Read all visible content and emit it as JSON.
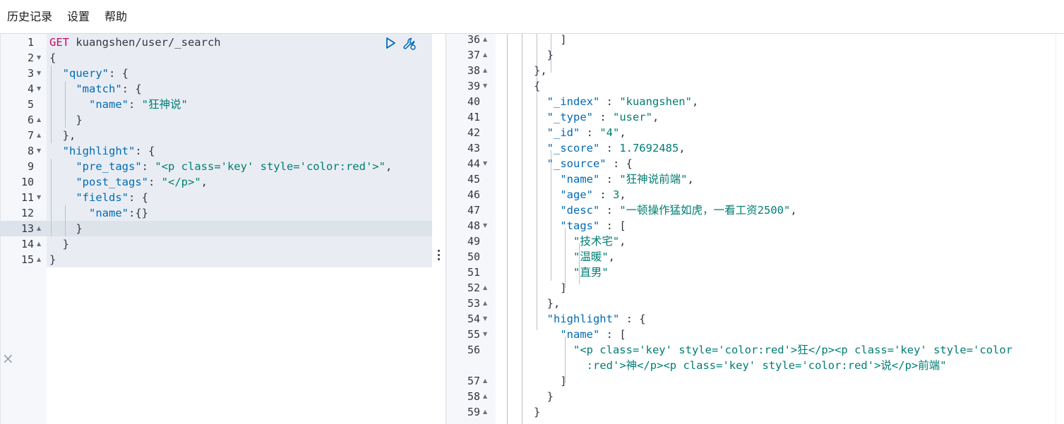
{
  "menu": {
    "history": "历史记录",
    "settings": "设置",
    "help": "帮助"
  },
  "request": {
    "lines": [
      {
        "n": "1",
        "fold": "",
        "t": [
          [
            "k-method",
            "GET"
          ],
          [
            "k-url",
            " kuangshen/user/_search"
          ]
        ]
      },
      {
        "n": "2",
        "fold": "▼",
        "t": [
          [
            "k-punc",
            "{"
          ]
        ]
      },
      {
        "n": "3",
        "fold": "▼",
        "t": [
          [
            "k-punc",
            "  "
          ],
          [
            "k-key",
            "\"query\""
          ],
          [
            "k-punc",
            ": {"
          ]
        ]
      },
      {
        "n": "4",
        "fold": "▼",
        "t": [
          [
            "k-punc",
            "    "
          ],
          [
            "k-key",
            "\"match\""
          ],
          [
            "k-punc",
            ": {"
          ]
        ]
      },
      {
        "n": "5",
        "fold": "",
        "t": [
          [
            "k-punc",
            "      "
          ],
          [
            "k-key",
            "\"name\""
          ],
          [
            "k-punc",
            ": "
          ],
          [
            "k-str",
            "\"狂神说\""
          ]
        ]
      },
      {
        "n": "6",
        "fold": "▲",
        "t": [
          [
            "k-punc",
            "    }"
          ]
        ]
      },
      {
        "n": "7",
        "fold": "▲",
        "t": [
          [
            "k-punc",
            "  },"
          ]
        ]
      },
      {
        "n": "8",
        "fold": "▼",
        "t": [
          [
            "k-punc",
            "  "
          ],
          [
            "k-key",
            "\"highlight\""
          ],
          [
            "k-punc",
            ": {"
          ]
        ]
      },
      {
        "n": "9",
        "fold": "",
        "t": [
          [
            "k-punc",
            "    "
          ],
          [
            "k-key",
            "\"pre_tags\""
          ],
          [
            "k-punc",
            ": "
          ],
          [
            "k-str",
            "\"<p class='key' style='color:red'>\""
          ],
          [
            "k-punc",
            ","
          ]
        ]
      },
      {
        "n": "10",
        "fold": "",
        "t": [
          [
            "k-punc",
            "    "
          ],
          [
            "k-key",
            "\"post_tags\""
          ],
          [
            "k-punc",
            ": "
          ],
          [
            "k-str",
            "\"</p>\""
          ],
          [
            "k-punc",
            ","
          ]
        ]
      },
      {
        "n": "11",
        "fold": "▼",
        "t": [
          [
            "k-punc",
            "    "
          ],
          [
            "k-key",
            "\"fields\""
          ],
          [
            "k-punc",
            ": {"
          ]
        ]
      },
      {
        "n": "12",
        "fold": "",
        "t": [
          [
            "k-punc",
            "      "
          ],
          [
            "k-key",
            "\"name\""
          ],
          [
            "k-punc",
            ":{}"
          ]
        ]
      },
      {
        "n": "13",
        "fold": "▲",
        "t": [
          [
            "k-punc",
            "    }"
          ]
        ]
      },
      {
        "n": "14",
        "fold": "▲",
        "t": [
          [
            "k-punc",
            "  }"
          ]
        ]
      },
      {
        "n": "15",
        "fold": "▲",
        "t": [
          [
            "k-punc",
            "}"
          ]
        ]
      }
    ]
  },
  "response": {
    "lines": [
      {
        "n": "36",
        "fold": "▲",
        "t": [
          [
            "k-punc",
            "          ]"
          ]
        ]
      },
      {
        "n": "37",
        "fold": "▲",
        "t": [
          [
            "k-punc",
            "        }"
          ]
        ]
      },
      {
        "n": "38",
        "fold": "▲",
        "t": [
          [
            "k-punc",
            "      },"
          ]
        ]
      },
      {
        "n": "39",
        "fold": "▼",
        "t": [
          [
            "k-punc",
            "      {"
          ]
        ]
      },
      {
        "n": "40",
        "fold": "",
        "t": [
          [
            "k-punc",
            "        "
          ],
          [
            "k-key",
            "\"_index\""
          ],
          [
            "k-punc",
            " : "
          ],
          [
            "k-str",
            "\"kuangshen\""
          ],
          [
            "k-punc",
            ","
          ]
        ]
      },
      {
        "n": "41",
        "fold": "",
        "t": [
          [
            "k-punc",
            "        "
          ],
          [
            "k-key",
            "\"_type\""
          ],
          [
            "k-punc",
            " : "
          ],
          [
            "k-str",
            "\"user\""
          ],
          [
            "k-punc",
            ","
          ]
        ]
      },
      {
        "n": "42",
        "fold": "",
        "t": [
          [
            "k-punc",
            "        "
          ],
          [
            "k-key",
            "\"_id\""
          ],
          [
            "k-punc",
            " : "
          ],
          [
            "k-str",
            "\"4\""
          ],
          [
            "k-punc",
            ","
          ]
        ]
      },
      {
        "n": "43",
        "fold": "",
        "t": [
          [
            "k-punc",
            "        "
          ],
          [
            "k-key",
            "\"_score\""
          ],
          [
            "k-punc",
            " : "
          ],
          [
            "k-num",
            "1.7692485"
          ],
          [
            "k-punc",
            ","
          ]
        ]
      },
      {
        "n": "44",
        "fold": "▼",
        "t": [
          [
            "k-punc",
            "        "
          ],
          [
            "k-key",
            "\"_source\""
          ],
          [
            "k-punc",
            " : {"
          ]
        ]
      },
      {
        "n": "45",
        "fold": "",
        "t": [
          [
            "k-punc",
            "          "
          ],
          [
            "k-key",
            "\"name\""
          ],
          [
            "k-punc",
            " : "
          ],
          [
            "k-str",
            "\"狂神说前端\""
          ],
          [
            "k-punc",
            ","
          ]
        ]
      },
      {
        "n": "46",
        "fold": "",
        "t": [
          [
            "k-punc",
            "          "
          ],
          [
            "k-key",
            "\"age\""
          ],
          [
            "k-punc",
            " : "
          ],
          [
            "k-num",
            "3"
          ],
          [
            "k-punc",
            ","
          ]
        ]
      },
      {
        "n": "47",
        "fold": "",
        "t": [
          [
            "k-punc",
            "          "
          ],
          [
            "k-key",
            "\"desc\""
          ],
          [
            "k-punc",
            " : "
          ],
          [
            "k-str",
            "\"一顿操作猛如虎，一看工资2500\""
          ],
          [
            "k-punc",
            ","
          ]
        ]
      },
      {
        "n": "48",
        "fold": "▼",
        "t": [
          [
            "k-punc",
            "          "
          ],
          [
            "k-key",
            "\"tags\""
          ],
          [
            "k-punc",
            " : ["
          ]
        ]
      },
      {
        "n": "49",
        "fold": "",
        "t": [
          [
            "k-punc",
            "            "
          ],
          [
            "k-str",
            "\"技术宅\""
          ],
          [
            "k-punc",
            ","
          ]
        ]
      },
      {
        "n": "50",
        "fold": "",
        "t": [
          [
            "k-punc",
            "            "
          ],
          [
            "k-str",
            "\"温暖\""
          ],
          [
            "k-punc",
            ","
          ]
        ]
      },
      {
        "n": "51",
        "fold": "",
        "t": [
          [
            "k-punc",
            "            "
          ],
          [
            "k-str",
            "\"直男\""
          ]
        ]
      },
      {
        "n": "52",
        "fold": "▲",
        "t": [
          [
            "k-punc",
            "          ]"
          ]
        ]
      },
      {
        "n": "53",
        "fold": "▲",
        "t": [
          [
            "k-punc",
            "        },"
          ]
        ]
      },
      {
        "n": "54",
        "fold": "▼",
        "t": [
          [
            "k-punc",
            "        "
          ],
          [
            "k-key",
            "\"highlight\""
          ],
          [
            "k-punc",
            " : {"
          ]
        ]
      },
      {
        "n": "55",
        "fold": "▼",
        "t": [
          [
            "k-punc",
            "          "
          ],
          [
            "k-key",
            "\"name\""
          ],
          [
            "k-punc",
            " : ["
          ]
        ]
      },
      {
        "n": "56",
        "fold": "",
        "t": [
          [
            "k-punc",
            "            "
          ],
          [
            "k-str",
            "\"<p class='key' style='color:red'>狂</p><p class='key' style='color"
          ]
        ]
      },
      {
        "n": "",
        "fold": "",
        "t": [
          [
            "k-punc",
            "              "
          ],
          [
            "k-str",
            ":red'>神</p><p class='key' style='color:red'>说</p>前端\""
          ]
        ]
      },
      {
        "n": "57",
        "fold": "▲",
        "t": [
          [
            "k-punc",
            "          ]"
          ]
        ]
      },
      {
        "n": "58",
        "fold": "▲",
        "t": [
          [
            "k-punc",
            "        }"
          ]
        ]
      },
      {
        "n": "59",
        "fold": "▲",
        "t": [
          [
            "k-punc",
            "      }"
          ]
        ]
      }
    ]
  }
}
